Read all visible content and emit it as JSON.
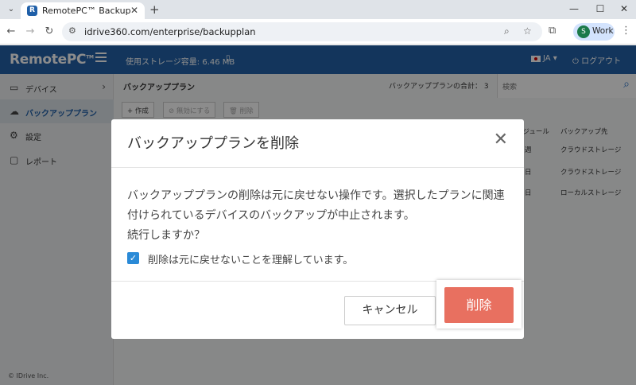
{
  "browser": {
    "tab_title": "RemotePC™ Backup",
    "url": "idrive360.com/enterprise/backupplan",
    "profile_initial": "S",
    "profile_label": "Work"
  },
  "header": {
    "logo": "RemotePC",
    "storage": "使用ストレージ容量: 6.46 MB",
    "language": "JA",
    "logout": "ログアウト"
  },
  "sidebar": {
    "items": [
      {
        "label": "デバイス",
        "icon": "devices-icon"
      },
      {
        "label": "バックアッププラン",
        "icon": "cloud-upload-icon"
      },
      {
        "label": "設定",
        "icon": "gear-icon"
      },
      {
        "label": "レポート",
        "icon": "document-icon"
      }
    ],
    "copyright": "© IDrive Inc."
  },
  "main": {
    "title": "バックアッププラン",
    "total": "バックアッププランの合計： 3",
    "search_placeholder": "検索",
    "buttons": {
      "create": "作成",
      "disable": "無効にする",
      "delete": "削除"
    },
    "columns": {
      "schedule": "ケジュール",
      "destination": "バックアップ先"
    },
    "rows": [
      {
        "schedule": "週",
        "destination": "クラウドストレージ"
      },
      {
        "schedule": "日",
        "destination": "クラウドストレージ"
      },
      {
        "schedule": "日",
        "destination": "ローカルストレージ"
      }
    ]
  },
  "dialog": {
    "title": "バックアッププランを削除",
    "message": "バックアッププランの削除は元に戻せない操作です。選択したプランに関連付けられているデバイスのバックアップが中止されます。\n続行しますか？",
    "checkbox_label": "削除は元に戻せないことを理解しています。",
    "checkbox_checked": true,
    "cancel_label": "キャンセル",
    "delete_label": "削除",
    "delete_color": "#e87060"
  }
}
